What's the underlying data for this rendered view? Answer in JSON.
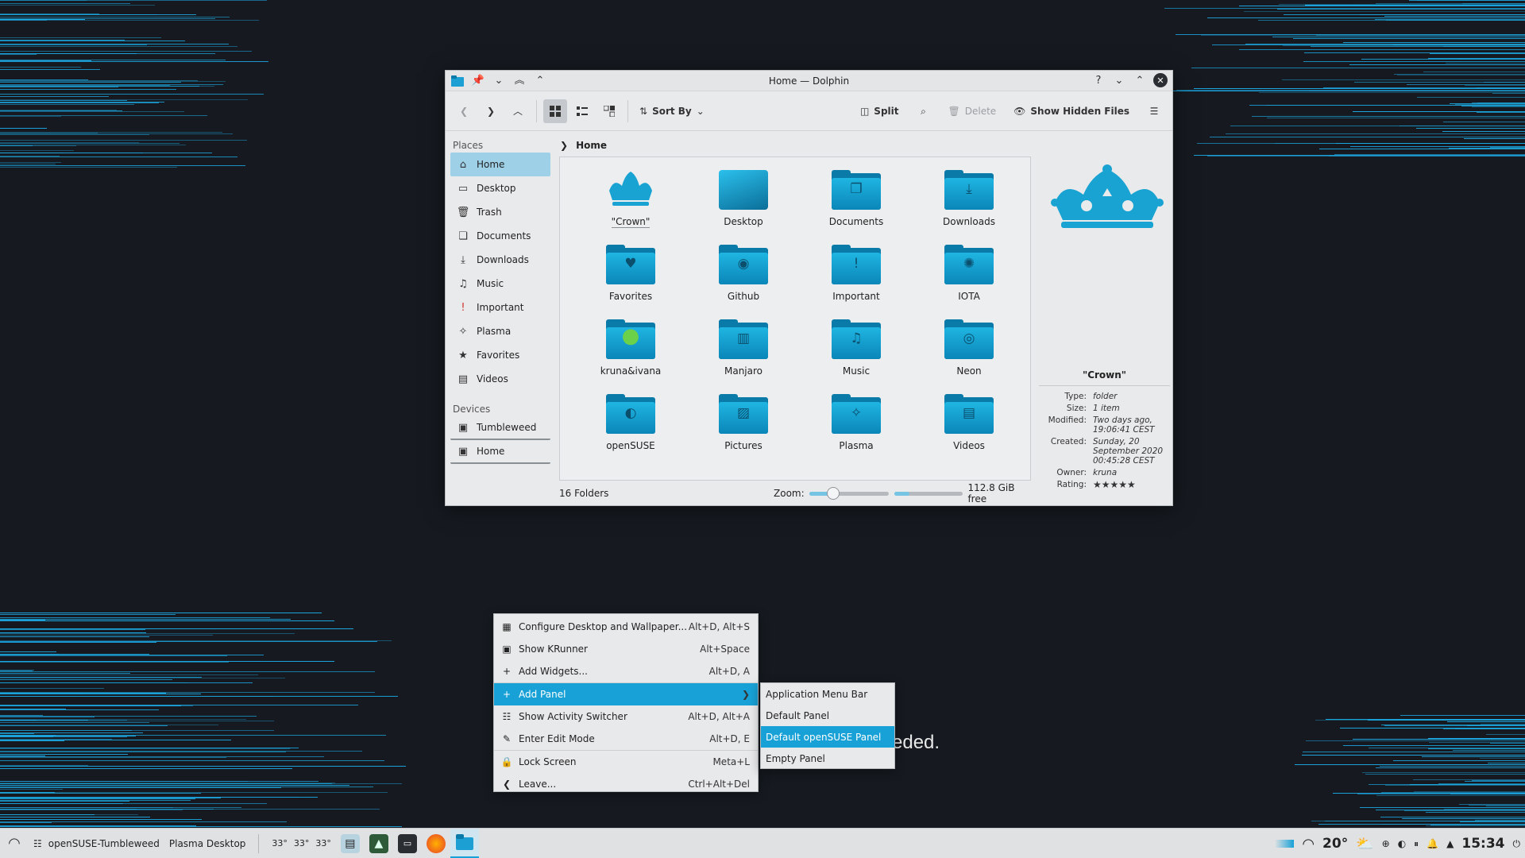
{
  "colors": {
    "accent": "#18a1d6",
    "wallpaper": "#161a20",
    "streak": "#1ca7e0",
    "folder": "#1fb5e2"
  },
  "wallpaper_text": "eded.",
  "window": {
    "title": "Home — Dolphin",
    "titlebar_icons": [
      "dolphin-app-icon",
      "pin-icon",
      "chevron-double-down-icon",
      "chevron-double-up-icon",
      "keep-above-icon"
    ],
    "toolbar": {
      "sort_by": "Sort By",
      "split": "Split",
      "delete": "Delete",
      "show_hidden": "Show Hidden Files"
    },
    "breadcrumb": {
      "current": "Home"
    },
    "sidebar": {
      "places_label": "Places",
      "places": [
        {
          "label": "Home",
          "icon": "home-icon"
        },
        {
          "label": "Desktop",
          "icon": "desktop-icon"
        },
        {
          "label": "Trash",
          "icon": "trash-icon"
        },
        {
          "label": "Documents",
          "icon": "documents-icon"
        },
        {
          "label": "Downloads",
          "icon": "downloads-icon"
        },
        {
          "label": "Music",
          "icon": "music-icon"
        },
        {
          "label": "Important",
          "icon": "important-icon"
        },
        {
          "label": "Plasma",
          "icon": "plasma-icon"
        },
        {
          "label": "Favorites",
          "icon": "star-icon"
        },
        {
          "label": "Videos",
          "icon": "videos-icon"
        }
      ],
      "devices_label": "Devices",
      "devices": [
        {
          "label": "Tumbleweed",
          "icon": "drive-icon"
        },
        {
          "label": "Home",
          "icon": "drive-icon"
        }
      ]
    },
    "folders": [
      {
        "label": "\"Crown\"",
        "glyph": "crown"
      },
      {
        "label": "Desktop",
        "glyph": "desktop"
      },
      {
        "label": "Documents",
        "glyph": "doc"
      },
      {
        "label": "Downloads",
        "glyph": "download"
      },
      {
        "label": "Favorites",
        "glyph": "heart"
      },
      {
        "label": "Github",
        "glyph": "github"
      },
      {
        "label": "Important",
        "glyph": "important"
      },
      {
        "label": "IOTA",
        "glyph": "iota"
      },
      {
        "label": "kruna&ivana",
        "glyph": "chameleon"
      },
      {
        "label": "Manjaro",
        "glyph": "manjaro"
      },
      {
        "label": "Music",
        "glyph": "music"
      },
      {
        "label": "Neon",
        "glyph": "neon"
      },
      {
        "label": "openSUSE",
        "glyph": "opensuse"
      },
      {
        "label": "Pictures",
        "glyph": "pictures"
      },
      {
        "label": "Plasma",
        "glyph": "plasma"
      },
      {
        "label": "Videos",
        "glyph": "videos"
      }
    ],
    "status": {
      "count": "16 Folders",
      "zoom_label": "Zoom:",
      "zoom_level": 0.3,
      "free_space": "112.8 GiB free",
      "disk_used_fraction": 0.22
    },
    "info": {
      "name": "\"Crown\"",
      "rows": [
        {
          "k": "Type:",
          "v": "folder"
        },
        {
          "k": "Size:",
          "v": "1 item"
        },
        {
          "k": "Modified:",
          "v": "Two days ago, 19:06:41 CEST"
        },
        {
          "k": "Created:",
          "v": "Sunday, 20 September 2020 00:45:28 CEST"
        },
        {
          "k": "Owner:",
          "v": "kruna"
        }
      ],
      "rating_label": "Rating:",
      "rating": "★★★★★",
      "rating_value": 5
    }
  },
  "context_menu": {
    "items": [
      {
        "label": "Configure Desktop and Wallpaper...",
        "shortcut": "Alt+D, Alt+S",
        "icon": "wallpaper-icon"
      },
      {
        "label": "Show KRunner",
        "shortcut": "Alt+Space",
        "icon": "krunner-icon"
      },
      {
        "label": "Add Widgets...",
        "shortcut": "Alt+D, A",
        "icon": "plus-icon"
      },
      {
        "label": "Add Panel",
        "shortcut": "",
        "icon": "plus-icon"
      },
      {
        "label": "Show Activity Switcher",
        "shortcut": "Alt+D, Alt+A",
        "icon": "activities-icon"
      },
      {
        "label": "Enter Edit Mode",
        "shortcut": "Alt+D, E",
        "icon": "pencil-icon"
      },
      {
        "label": "Lock Screen",
        "shortcut": "Meta+L",
        "icon": "lock-icon"
      },
      {
        "label": "Leave...",
        "shortcut": "Ctrl+Alt+Del",
        "icon": "leave-icon"
      }
    ],
    "submenu": [
      "Application Menu Bar",
      "Default Panel",
      "Default openSUSE Panel",
      "Empty Panel"
    ]
  },
  "taskbar": {
    "activity": "openSUSE-Tumbleweed",
    "desktop": "Plasma Desktop",
    "temps": [
      "33°",
      "33°",
      "33°"
    ],
    "weather": "20°",
    "clock": "15:34"
  }
}
